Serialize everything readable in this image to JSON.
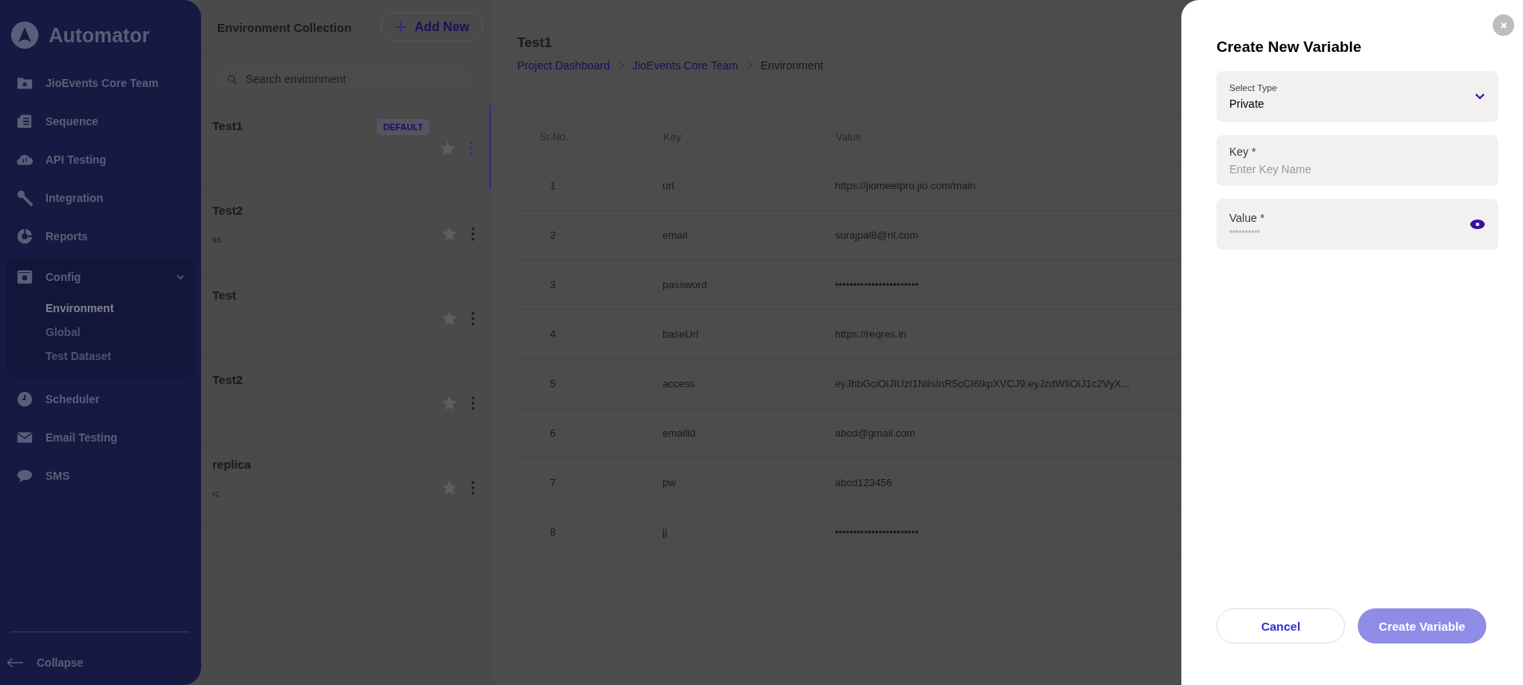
{
  "sidebar": {
    "logo": "Automator",
    "items": [
      {
        "label": "JioEvents Core Team"
      },
      {
        "label": "Sequence"
      },
      {
        "label": "API Testing"
      },
      {
        "label": "Integration"
      },
      {
        "label": "Reports"
      },
      {
        "label": "Config",
        "expanded": true,
        "children": [
          {
            "label": "Environment",
            "selected": true
          },
          {
            "label": "Global",
            "selected": false
          },
          {
            "label": "Test Dataset",
            "selected": false
          }
        ]
      },
      {
        "label": "Scheduler"
      },
      {
        "label": "Email Testing"
      },
      {
        "label": "SMS"
      }
    ],
    "collapse": "Collapse"
  },
  "environments": {
    "title": "Environment Collection",
    "add_button": "Add New",
    "search": {
      "placeholder": "Search environment"
    },
    "items": [
      {
        "name": "Test1",
        "badge": "DEFAULT",
        "selected": true
      },
      {
        "name": "Test2",
        "description": "ss",
        "selected": false
      },
      {
        "name": "Test",
        "selected": false
      },
      {
        "name": "Test2",
        "selected": false
      },
      {
        "name": "replica",
        "description": "rc",
        "selected": false
      }
    ]
  },
  "main": {
    "title": "Test1",
    "breadcrumb": [
      {
        "label": "Project Dashboard",
        "link": true
      },
      {
        "label": "JioEvents Core Team",
        "link": true
      },
      {
        "label": "Environment",
        "link": false
      }
    ],
    "table": {
      "columns": [
        "Sr.No.",
        "Key",
        "Value"
      ],
      "rows": [
        [
          "1",
          "url",
          "https://jiomeetpro.jio.com/main"
        ],
        [
          "2",
          "email",
          "surajpal8@ril.com"
        ],
        [
          "3",
          "password",
          "•••••••••••••••••••••••"
        ],
        [
          "4",
          "baseUrl",
          "https://reqres.in"
        ],
        [
          "5",
          "access",
          "eyJhbGciOiJIUzI1NiIsInR5cCI6IkpXVCJ9.eyJzdWIiOiJ1c2VyX..."
        ],
        [
          "6",
          "emailid",
          "abcd@gmail.com"
        ],
        [
          "7",
          "pw",
          "abcd123456"
        ],
        [
          "8",
          "jj",
          "•••••••••••••••••••••••"
        ]
      ]
    }
  },
  "drawer": {
    "title": "Create New Variable",
    "fields": [
      {
        "kind": "select",
        "label": "Select Type",
        "value": "Private"
      },
      {
        "kind": "text",
        "label": "Key *",
        "placeholder": "Enter Key Name"
      },
      {
        "kind": "password",
        "label": "Value *",
        "placeholder": "**********"
      }
    ],
    "buttons": [
      {
        "label": "Cancel",
        "kind": "secondary",
        "disabled": false
      },
      {
        "label": "Create Variable",
        "kind": "primary",
        "disabled": true
      }
    ]
  }
}
